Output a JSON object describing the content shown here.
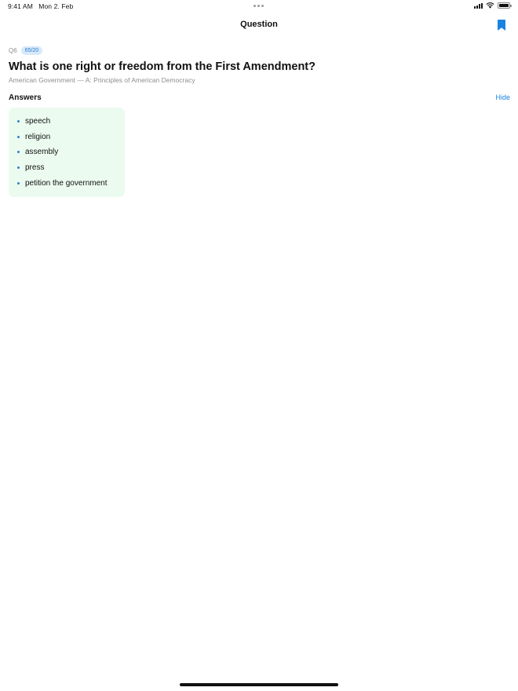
{
  "status_bar": {
    "time": "9:41 AM",
    "date": "Mon 2. Feb",
    "battery_level": 1.0
  },
  "nav": {
    "title": "Question",
    "bookmark_icon": "bookmark-icon",
    "accent_color": "#1a82e0"
  },
  "question": {
    "number": "Q6",
    "score_badge": "65/20",
    "text": "What is one right or freedom from the First Amendment?",
    "category": "American Government — A: Principles of American Democracy"
  },
  "answers": {
    "title": "Answers",
    "hide_label": "Hide",
    "card_color": "#ecfbf0",
    "items": [
      {
        "label": "speech"
      },
      {
        "label": "religion"
      },
      {
        "label": "assembly"
      },
      {
        "label": "press"
      },
      {
        "label": "petition the government"
      }
    ]
  }
}
